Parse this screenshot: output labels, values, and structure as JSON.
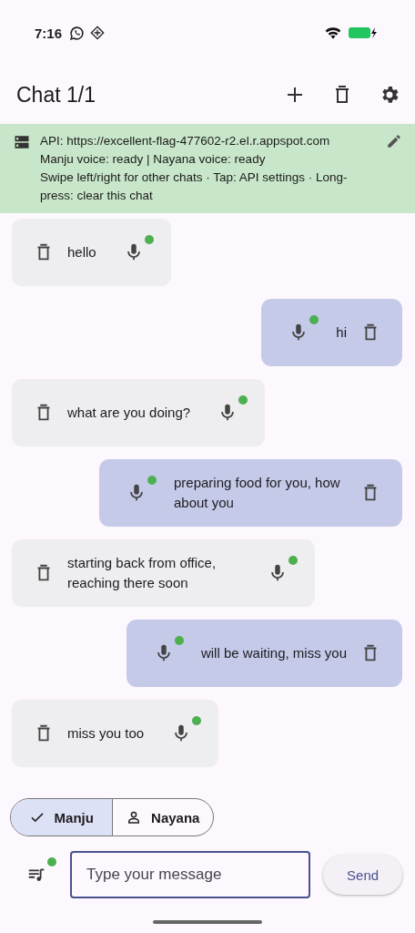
{
  "status_bar": {
    "time": "7:16"
  },
  "app_bar": {
    "title": "Chat 1/1"
  },
  "banner": {
    "lines": [
      "API: https://excellent-flag-477602-r2.el.r.appspot.com",
      "Manju voice: ready | Nayana voice: ready",
      "Swipe left/right for other chats · Tap: API settings · Long-press: clear this chat"
    ]
  },
  "messages": [
    {
      "kind": "received",
      "text": "hello",
      "voice_ready": true
    },
    {
      "kind": "sent",
      "text": "hi",
      "voice_ready": true
    },
    {
      "kind": "received",
      "text": "what are you doing?",
      "voice_ready": true
    },
    {
      "kind": "sent",
      "text": "preparing food for you, how about you",
      "voice_ready": true
    },
    {
      "kind": "received",
      "text": "starting back from office, reaching there soon",
      "voice_ready": true
    },
    {
      "kind": "sent",
      "text": "will be waiting, miss you",
      "voice_ready": true
    },
    {
      "kind": "received",
      "text": "miss you too",
      "voice_ready": true
    }
  ],
  "speakers": [
    {
      "label": "Manju",
      "selected": true
    },
    {
      "label": "Nayana",
      "selected": false
    }
  ],
  "composer": {
    "voice_ready": true,
    "placeholder": "Type your message",
    "send": "Send"
  }
}
